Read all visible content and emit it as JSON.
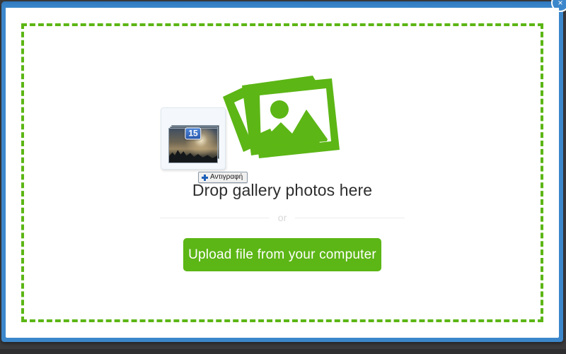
{
  "window": {
    "frame_color": "#3c87cb",
    "body_background": "#ffffff",
    "close_icon_name": "close-icon",
    "close_label": "×"
  },
  "desktop": {
    "background_color": "#3a3a3c"
  },
  "dropzone": {
    "border_color": "#5cb615",
    "border_style": "dashed",
    "gallery_icon_name": "gallery-photos-icon",
    "gallery_icon_color": "#5cb615",
    "drop_label": "Drop gallery photos here",
    "divider_label": "or",
    "upload_button_label": "Upload file from your computer",
    "upload_button_color": "#5cb615"
  },
  "drag_operation": {
    "ghost_name": "drag-ghost-photo-stack",
    "photo_count": "15",
    "count_badge_color": "#2a59ad",
    "action_label": "Αντιγραφή",
    "action_icon_name": "plus-icon",
    "action_icon_color": "#1c5fb8"
  }
}
